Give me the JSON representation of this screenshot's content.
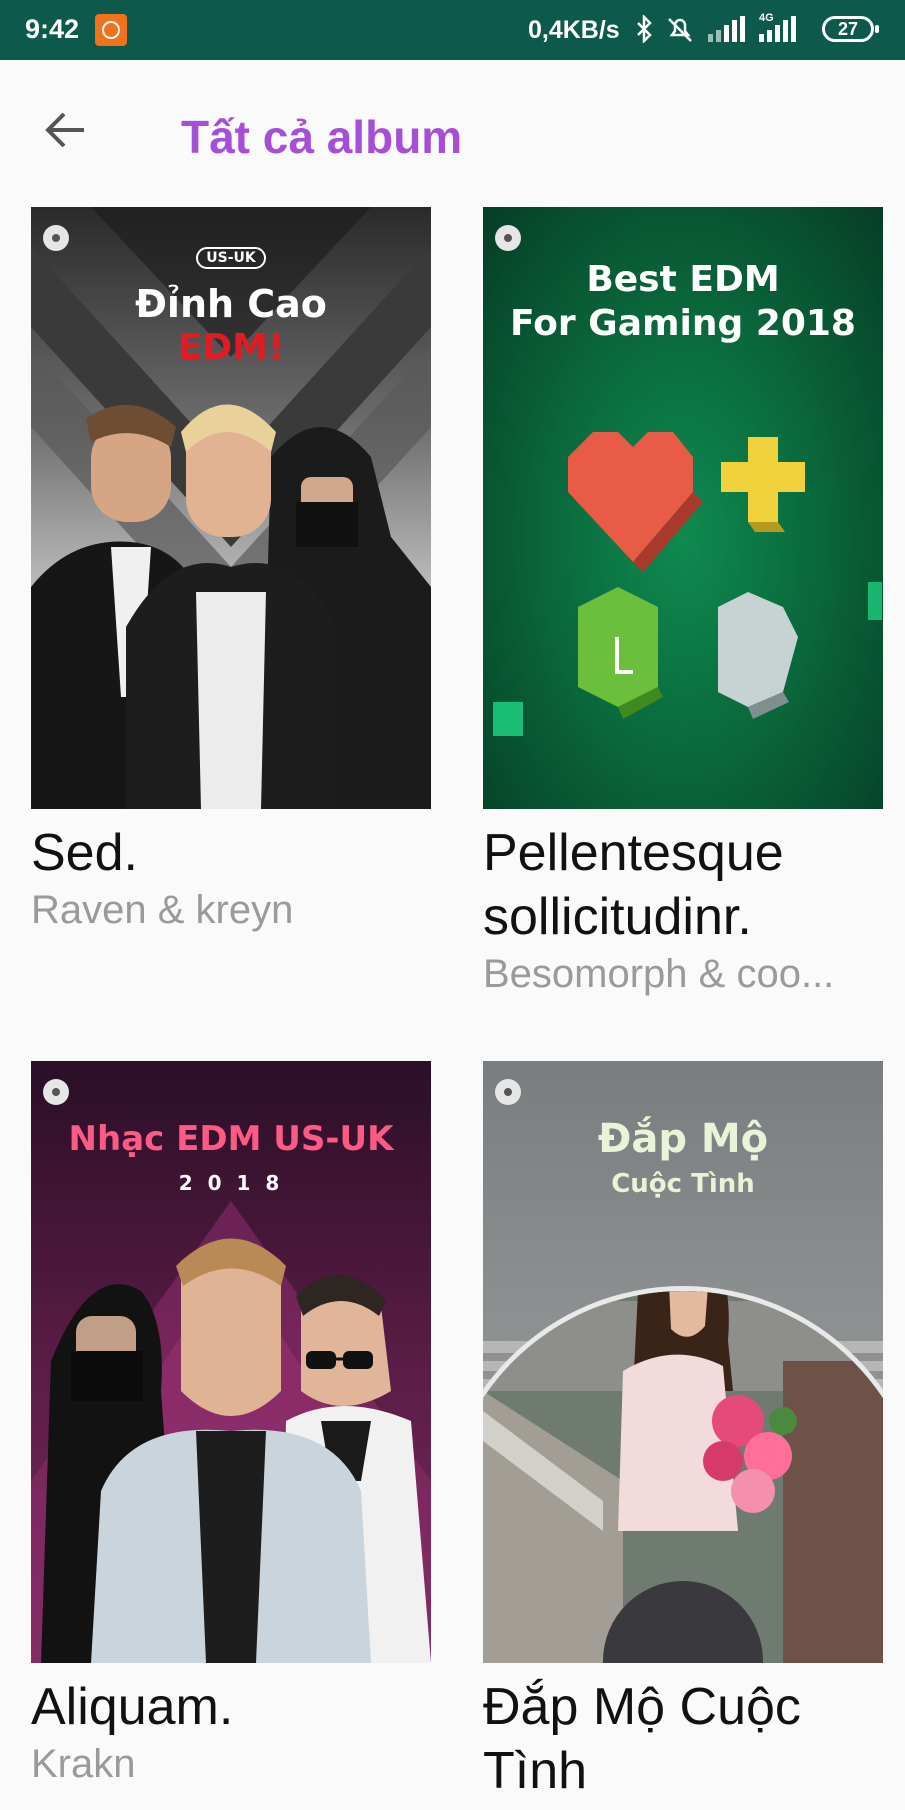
{
  "status_bar": {
    "time": "9:42",
    "network_speed": "0,4KB/s",
    "battery": "27",
    "network_type": "4G",
    "icons": [
      "app-notification-icon",
      "bluetooth-icon",
      "mute-icon",
      "signal-icon",
      "signal-4g-icon",
      "battery-icon"
    ]
  },
  "app_bar": {
    "title": "Tất cả album",
    "back_icon": "arrow-left-icon",
    "accent": "#a44fd6"
  },
  "albums": [
    {
      "title": "Sed.",
      "artist": "Raven & kreyn",
      "cover": {
        "badge": "US-UK",
        "line1": "Đỉnh Cao",
        "line2": "EDM!"
      }
    },
    {
      "title": "Pellentesque sollicitudinr.",
      "artist": "Besomorph & coo...",
      "cover": {
        "line1": "Best EDM",
        "line2": "For Gaming 2018",
        "tile_letter": "L"
      }
    },
    {
      "title": "Aliquam.",
      "artist": "Krakn",
      "cover": {
        "line1": "Nhạc EDM US-UK",
        "line2": "2 0 1 8"
      }
    },
    {
      "title": "Đắp Mộ Cuộc Tình",
      "artist": "",
      "cover": {
        "line1": "Đắp Mộ",
        "line2": "Cuộc Tình"
      }
    }
  ]
}
